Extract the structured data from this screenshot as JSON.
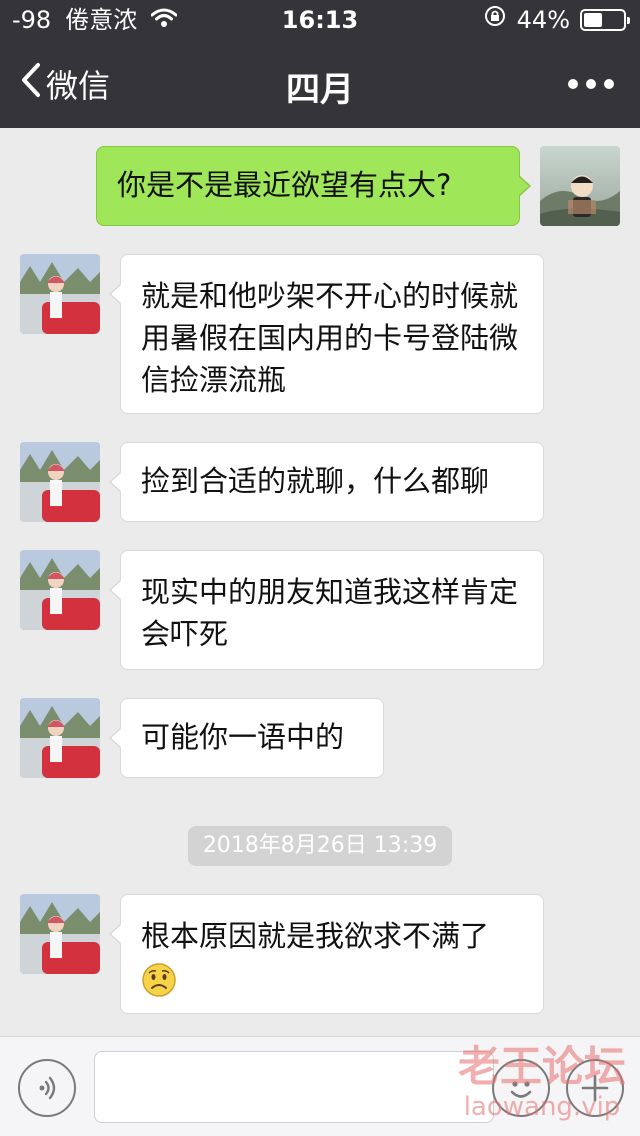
{
  "status_bar": {
    "signal": "-98",
    "carrier": "倦意浓",
    "time": "16:13",
    "battery": "44%",
    "battery_level": 0.44
  },
  "nav": {
    "back_label": "微信",
    "title": "四月",
    "more_icon": "more-dots-icon"
  },
  "messages": [
    {
      "side": "self",
      "text": "你是不是最近欲望有点大?"
    },
    {
      "side": "other",
      "text": "就是和他吵架不开心的时候就用暑假在国内用的卡号登陆微信捡漂流瓶"
    },
    {
      "side": "other",
      "text": "捡到合适的就聊，什么都聊"
    },
    {
      "side": "other",
      "text": "现实中的朋友知道我这样肯定会吓死"
    },
    {
      "side": "other",
      "text": "可能你一语中的"
    },
    {
      "side": "other",
      "text": "根本原因就是我欲求不满了",
      "emoji": "sad-face-emoji"
    }
  ],
  "timestamp": "2018年8月26日 13:39",
  "input_bar": {
    "voice_icon": "voice-icon",
    "emoji_icon": "emoji-icon",
    "plus_icon": "plus-icon"
  },
  "watermark": {
    "top": "老王论坛",
    "bottom": "laowang.vip"
  },
  "colors": {
    "header_bg": "#353539",
    "chat_bg": "#ebebeb",
    "self_bubble": "#9fe658",
    "other_bubble": "#ffffff"
  }
}
